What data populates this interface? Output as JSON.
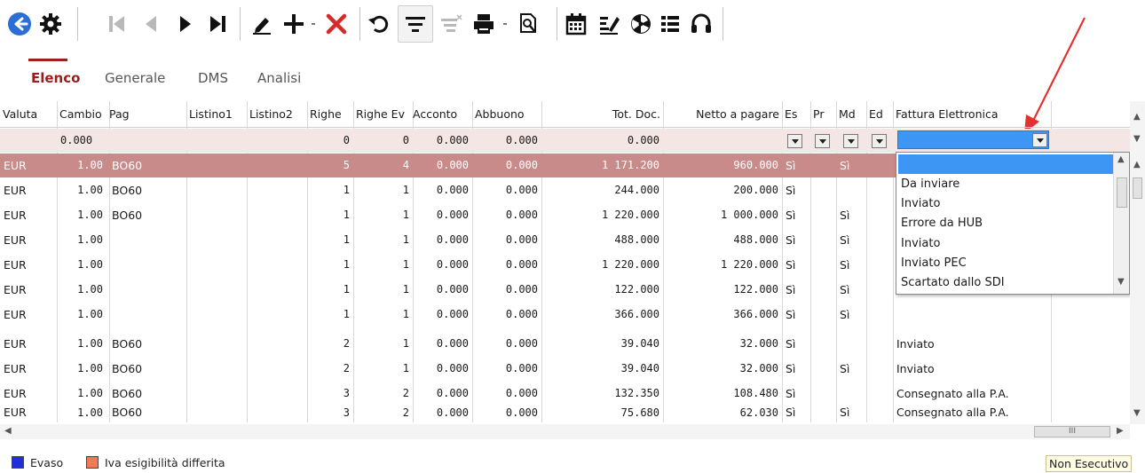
{
  "colors": {
    "accent": "#9b1f1f",
    "selected_row": "#c98b89",
    "selection_blue": "#3d95f4",
    "delete_red": "#d42a2a"
  },
  "toolbar": {
    "icons": [
      "back-circle-icon",
      "gear-icon",
      "first-record-icon",
      "previous-record-icon",
      "next-record-icon",
      "last-record-icon",
      "edit-pencil-icon",
      "add-plus-icon",
      "delete-x-icon",
      "refresh-icon",
      "filter-icon",
      "clear-filter-icon",
      "print-icon",
      "preview-search-icon",
      "calendar-icon",
      "edit-document-icon",
      "fan-icon",
      "list-icon",
      "headset-icon"
    ]
  },
  "tabs": [
    "Elenco",
    "Generale",
    "DMS",
    "Analisi"
  ],
  "columns": [
    "Valuta",
    "Cambio",
    "Pag",
    "Listino1",
    "Listino2",
    "Righe",
    "Righe Ev",
    "Acconto",
    "Abbuono",
    "Tot. Doc.",
    "Netto a pagare",
    "Es",
    "Pr",
    "Md",
    "Ed",
    "Fattura Elettronica"
  ],
  "filter_row": {
    "cambio": "0.000",
    "righe": "0",
    "righe_ev": "0",
    "acconto": "0.000",
    "abbuono": "0.000",
    "tot_doc": "0.000"
  },
  "rows": [
    {
      "valuta": "EUR",
      "cambio": "1.00",
      "pag": "BO60",
      "righe": "5",
      "righe_ev": "4",
      "acconto": "0.000",
      "abbuono": "0.000",
      "tot": "1 171.200",
      "netto": "960.000",
      "es": "Sì",
      "md": "Sì",
      "fe": ""
    },
    {
      "valuta": "EUR",
      "cambio": "1.00",
      "pag": "BO60",
      "righe": "1",
      "righe_ev": "1",
      "acconto": "0.000",
      "abbuono": "0.000",
      "tot": "244.000",
      "netto": "200.000",
      "es": "Sì",
      "md": "",
      "fe": ""
    },
    {
      "valuta": "EUR",
      "cambio": "1.00",
      "pag": "BO60",
      "righe": "1",
      "righe_ev": "1",
      "acconto": "0.000",
      "abbuono": "0.000",
      "tot": "1 220.000",
      "netto": "1 000.000",
      "es": "Sì",
      "md": "Sì",
      "fe": ""
    },
    {
      "valuta": "EUR",
      "cambio": "1.00",
      "pag": "",
      "righe": "1",
      "righe_ev": "1",
      "acconto": "0.000",
      "abbuono": "0.000",
      "tot": "488.000",
      "netto": "488.000",
      "es": "Sì",
      "md": "Sì",
      "fe": ""
    },
    {
      "valuta": "EUR",
      "cambio": "1.00",
      "pag": "",
      "righe": "1",
      "righe_ev": "1",
      "acconto": "0.000",
      "abbuono": "0.000",
      "tot": "1 220.000",
      "netto": "1 220.000",
      "es": "Sì",
      "md": "Sì",
      "fe": ""
    },
    {
      "valuta": "EUR",
      "cambio": "1.00",
      "pag": "",
      "righe": "1",
      "righe_ev": "1",
      "acconto": "0.000",
      "abbuono": "0.000",
      "tot": "122.000",
      "netto": "122.000",
      "es": "Sì",
      "md": "Sì",
      "fe": ""
    },
    {
      "valuta": "EUR",
      "cambio": "1.00",
      "pag": "",
      "righe": "1",
      "righe_ev": "1",
      "acconto": "0.000",
      "abbuono": "0.000",
      "tot": "366.000",
      "netto": "366.000",
      "es": "Sì",
      "md": "Sì",
      "fe": ""
    },
    {
      "valuta": "EUR",
      "cambio": "1.00",
      "pag": "BO60",
      "righe": "2",
      "righe_ev": "1",
      "acconto": "0.000",
      "abbuono": "0.000",
      "tot": "39.040",
      "netto": "32.000",
      "es": "Sì",
      "md": "",
      "fe": "Inviato"
    },
    {
      "valuta": "EUR",
      "cambio": "1.00",
      "pag": "BO60",
      "righe": "2",
      "righe_ev": "1",
      "acconto": "0.000",
      "abbuono": "0.000",
      "tot": "39.040",
      "netto": "32.000",
      "es": "Sì",
      "md": "Sì",
      "fe": "Inviato"
    },
    {
      "valuta": "EUR",
      "cambio": "1.00",
      "pag": "BO60",
      "righe": "3",
      "righe_ev": "2",
      "acconto": "0.000",
      "abbuono": "0.000",
      "tot": "132.350",
      "netto": "108.480",
      "es": "Sì",
      "md": "",
      "fe": "Consegnato alla P.A."
    },
    {
      "valuta": "EUR",
      "cambio": "1.00",
      "pag": "BO60",
      "righe": "3",
      "righe_ev": "2",
      "acconto": "0.000",
      "abbuono": "0.000",
      "tot": "75.680",
      "netto": "62.030",
      "es": "Sì",
      "md": "Sì",
      "fe": "Consegnato alla P.A."
    }
  ],
  "dropdown": {
    "selected": "",
    "options": [
      "Da inviare",
      "Inviato",
      "Errore da HUB",
      "Inviato",
      "Inviato PEC",
      "Scartato dallo SDI"
    ]
  },
  "scroll": {
    "h_thumb_label": "III"
  },
  "legend": [
    {
      "label": "Evaso",
      "color": "#1f2fe0"
    },
    {
      "label": "Iva esigibilità differita",
      "color": "#f07a55"
    }
  ],
  "mode_badge": "Non Esecutivo"
}
